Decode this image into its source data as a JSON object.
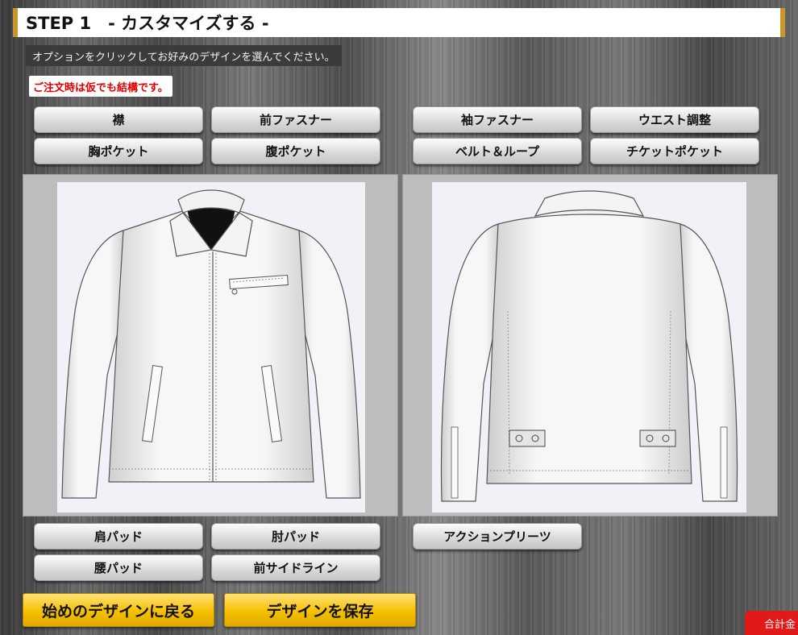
{
  "header": {
    "title": "STEP 1　- カスタマイズする -"
  },
  "instruction": "オプションをクリックしてお好みのデザインを選んでください。",
  "note": "ご注文時は仮でも結構です。",
  "options_top": [
    {
      "label": "襟"
    },
    {
      "label": "前ファスナー"
    },
    {
      "label": "袖ファスナー"
    },
    {
      "label": "ウエスト調整"
    },
    {
      "label": "胸ポケット"
    },
    {
      "label": "腹ポケット"
    },
    {
      "label": "ベルト＆ループ"
    },
    {
      "label": "チケットポケット"
    }
  ],
  "options_bottom": [
    {
      "label": "肩パッド"
    },
    {
      "label": "肘パッド"
    },
    {
      "label": "アクションプリーツ"
    },
    {
      "label": "腰パッド"
    },
    {
      "label": "前サイドライン"
    }
  ],
  "actions": {
    "reset": "始めのデザインに戻る",
    "save": "デザインを保存"
  },
  "total": {
    "label": "合計金"
  },
  "views": {
    "front": "jacket-front",
    "back": "jacket-back"
  },
  "colors": {
    "accent": "#c9962c",
    "gold_button": "#f6c000",
    "total_button": "#e11919",
    "note_text": "#e00000"
  }
}
